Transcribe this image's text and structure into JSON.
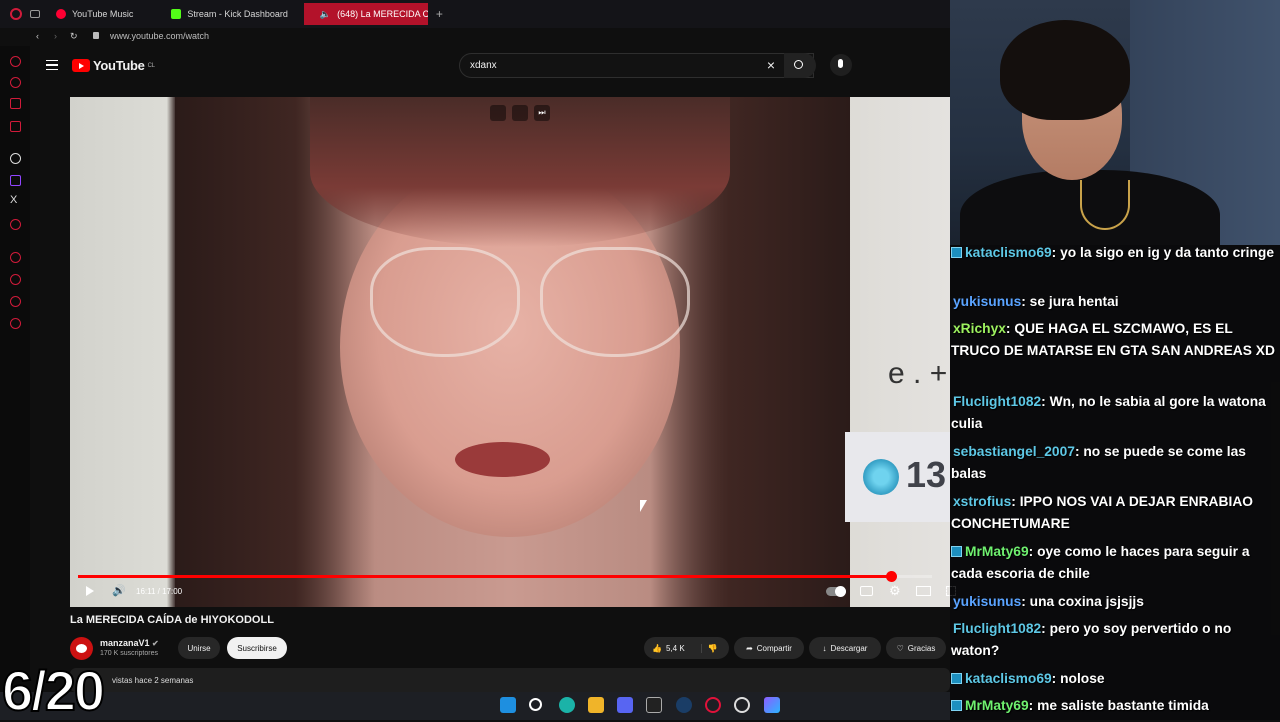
{
  "browser": {
    "tabs": [
      {
        "label": "YouTube Music",
        "color": "#ff0033"
      },
      {
        "label": "Stream - Kick Dashboard",
        "color": "#53fc18"
      },
      {
        "label": "(648) La MERECIDA C",
        "color": "#ffffff"
      }
    ],
    "url": "www.youtube.com/watch"
  },
  "youtube": {
    "logo": "YouTube",
    "logo_country": "CL",
    "search_value": "xdanx",
    "video": {
      "time": "16:11 / 17:00",
      "progress": 0.952,
      "badge_number": "13",
      "overlay_char": "e . +"
    },
    "title": "La MERECIDA CAÍDA de HIYOKODOLL",
    "channel": {
      "name": "manzanaV1",
      "subs": "170 K suscriptores",
      "join_label": "Unirse",
      "subscribe_label": "Suscribirse"
    },
    "actions": {
      "likes": "5,4 K",
      "share": "Compartir",
      "download": "Descargar",
      "thanks": "Gracias"
    },
    "description": "vistas  hace 2 semanas"
  },
  "counter": "6/20",
  "chat": [
    {
      "user": "kataclismo69",
      "text": ": yo la sigo en ig y da tanto cringe",
      "color": "cyan",
      "badge": true
    },
    {
      "user": "yukisunus",
      "text": ": se jura hentai",
      "color": "blue",
      "badge": false
    },
    {
      "user": "xRichyx",
      "text": ": QUE HAGA EL SZCMAWO, ES EL TRUCO DE MATARSE EN GTA SAN ANDREAS XD",
      "color": "lime",
      "badge": false
    },
    {
      "user": "Fluclight1082",
      "text": ": Wn, no le sabia al gore la watona culia",
      "color": "cyan",
      "badge": false
    },
    {
      "user": "sebastiangel_2007",
      "text": ": no se puede se come las balas",
      "color": "cyan",
      "badge": false
    },
    {
      "user": "xstrofius",
      "text": ": IPPO NOS VAI A DEJAR ENRABIAO CONCHETUMARE",
      "color": "cyan",
      "badge": false
    },
    {
      "user": "MrMaty69",
      "text": ": oye como le haces para seguir a cada escoria de chile",
      "color": "green",
      "badge": true
    },
    {
      "user": "yukisunus",
      "text": ": una coxina jsjsjjs",
      "color": "blue",
      "badge": false
    },
    {
      "user": "Fluclight1082",
      "text": ": pero yo soy pervertido o no waton?",
      "color": "cyan",
      "badge": false
    },
    {
      "user": "kataclismo69",
      "text": ": nolose",
      "color": "cyan",
      "badge": true
    },
    {
      "user": "MrMaty69",
      "text": ": me saliste bastante timida",
      "color": "green",
      "badge": true
    }
  ]
}
